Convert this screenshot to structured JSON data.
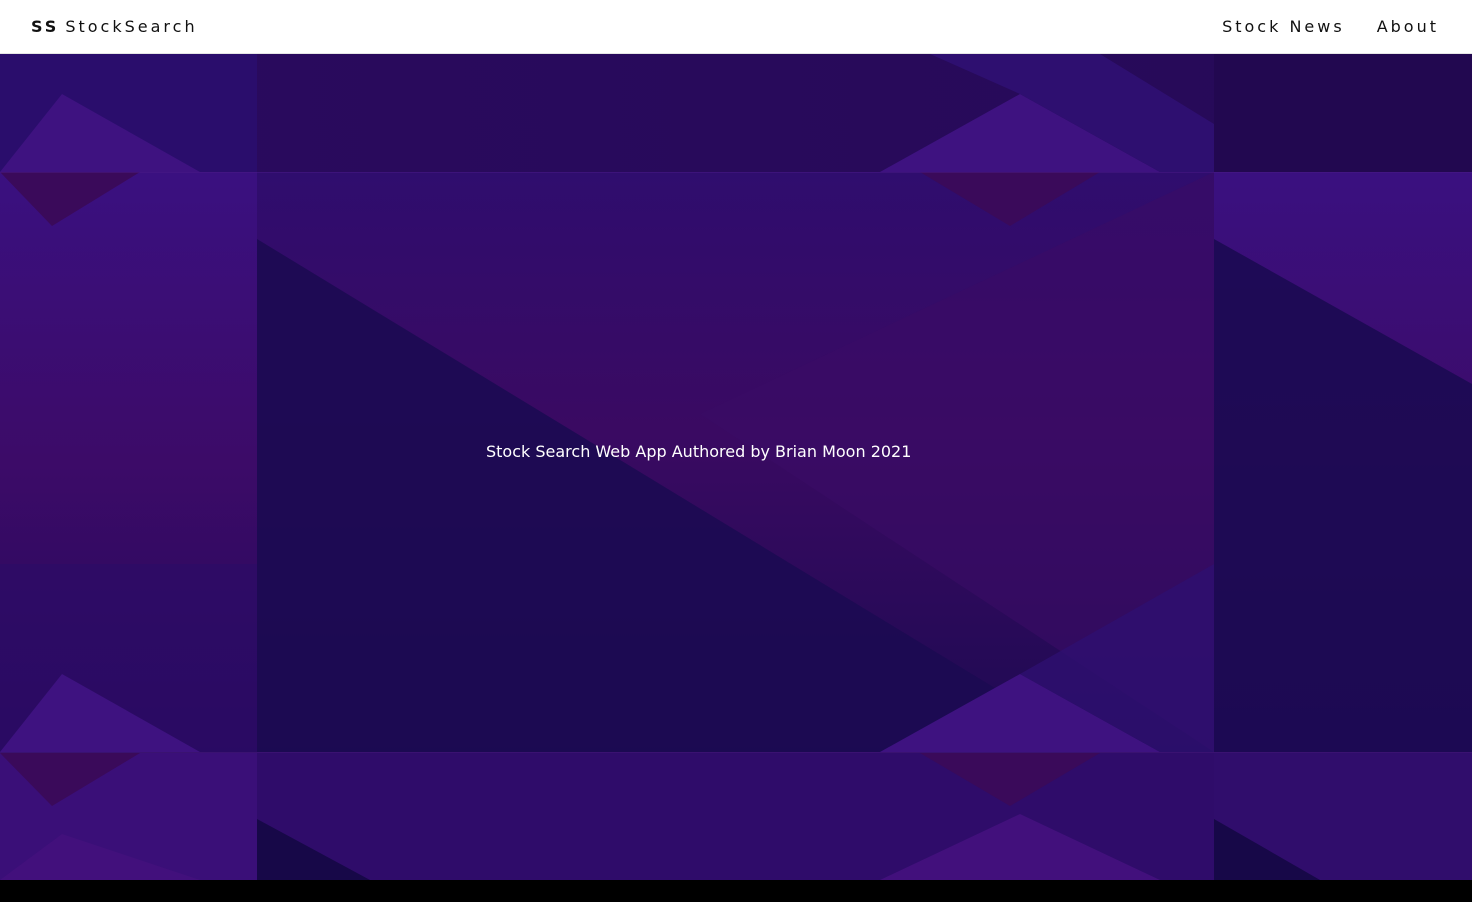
{
  "header": {
    "brand_abbr": "SS",
    "brand_name": "StockSearch",
    "nav": [
      {
        "label": "Stock News"
      },
      {
        "label": "About"
      }
    ]
  },
  "hero": {
    "tagline": "Stock Search Web App Authored by Brian Moon 2021"
  },
  "colors": {
    "header_bg": "#ffffff",
    "hero_base": "#2a0b5c",
    "hero_accent_light": "#44127a",
    "hero_accent_dark": "#170848",
    "text_on_hero": "#ffffff",
    "footer_bar": "#000000"
  }
}
